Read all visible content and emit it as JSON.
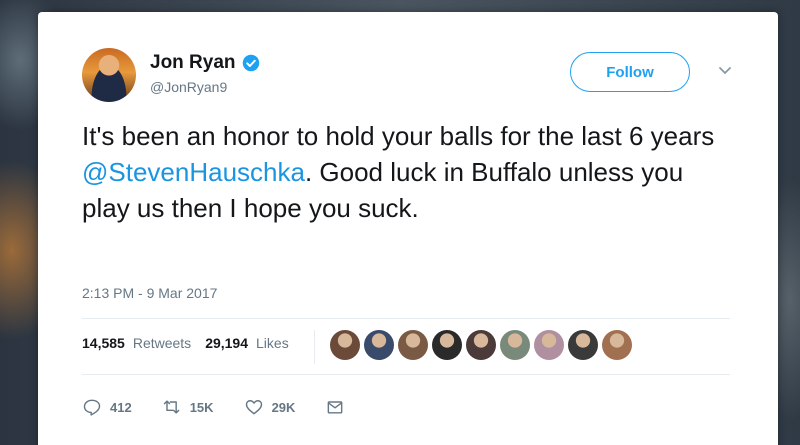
{
  "tweet": {
    "author_name": "Jon Ryan",
    "handle": "@JonRyan9",
    "follow_label": "Follow",
    "text_before": "It's been an honor to hold your balls for the last 6 years ",
    "mention": "@StevenHauschka",
    "text_after": ". Good luck in Buffalo unless you play us then I hope you suck.",
    "timestamp": "2:13 PM - 9 Mar 2017"
  },
  "stats": {
    "retweets_count": "14,585",
    "retweets_label": "Retweets",
    "likes_count": "29,194",
    "likes_label": "Likes"
  },
  "likers": [
    {
      "color": "#6b4a3a"
    },
    {
      "color": "#3a4a6a"
    },
    {
      "color": "#7a5a44"
    },
    {
      "color": "#2a2a2a"
    },
    {
      "color": "#4a3a3a"
    },
    {
      "color": "#7a8a7a"
    },
    {
      "color": "#b090a0"
    },
    {
      "color": "#3a3a3a"
    },
    {
      "color": "#a07050"
    }
  ],
  "actions": {
    "reply_count": "412",
    "retweet_count": "15K",
    "like_count": "29K"
  },
  "colors": {
    "accent": "#1da1f2",
    "mention": "#1b95e0",
    "text": "#14171a",
    "muted": "#657786"
  }
}
